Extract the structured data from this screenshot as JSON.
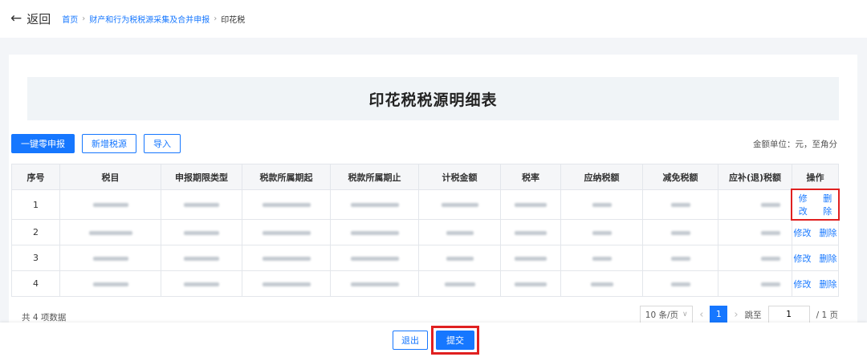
{
  "header": {
    "back_label": "返回",
    "breadcrumb": {
      "home": "首页",
      "parent": "财产和行为税税源采集及合并申报",
      "current": "印花税"
    }
  },
  "main": {
    "title": "印花税税源明细表",
    "toolbar": {
      "zero_declare": "一键零申报",
      "add_source": "新增税源",
      "import": "导入"
    },
    "unit_text": "金额单位：元，至角分",
    "table": {
      "columns": [
        "序号",
        "税目",
        "申报期限类型",
        "税款所属期起",
        "税款所属期止",
        "计税金额",
        "税率",
        "应纳税额",
        "减免税额",
        "应补(退)税额",
        "操作"
      ],
      "rows": [
        {
          "index": "1",
          "edit": "修改",
          "delete": "删除"
        },
        {
          "index": "2",
          "edit": "修改",
          "delete": "删除"
        },
        {
          "index": "3",
          "edit": "修改",
          "delete": "删除"
        },
        {
          "index": "4",
          "edit": "修改",
          "delete": "删除"
        }
      ]
    },
    "footer": {
      "total": "共 4 项数据",
      "page_size": "10 条/页",
      "current_page": "1",
      "jump_label": "跳至",
      "jump_value": "1",
      "page_total": "/ 1 页"
    }
  },
  "actions": {
    "exit": "退出",
    "submit": "提交"
  },
  "colors": {
    "accent": "#1677ff",
    "highlight": "#e02020"
  }
}
